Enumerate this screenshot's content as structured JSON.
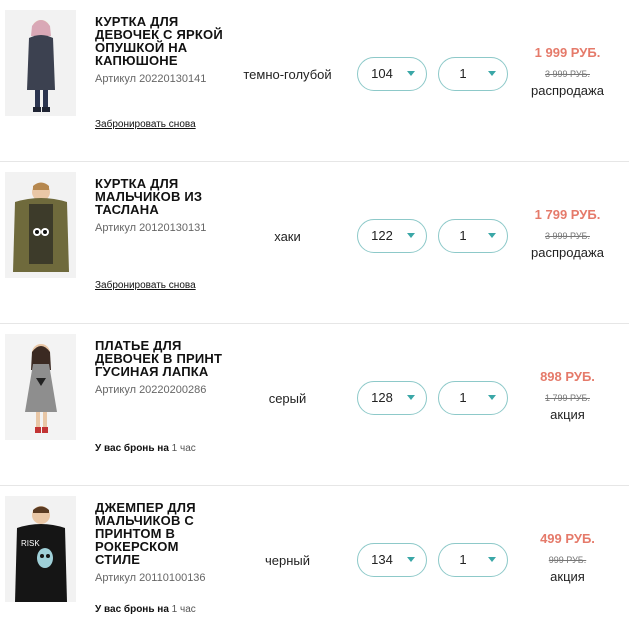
{
  "items": [
    {
      "title": "КУРТКА ДЛЯ ДЕВОЧЕК С ЯРКОЙ ОПУШКОЙ НА КАПЮШОНЕ",
      "sku": "Артикул 20220130141",
      "color": "темно-голубой",
      "size": "104",
      "qty": "1",
      "price": "1 999 РУБ.",
      "old_price": "3 999 РУБ.",
      "tag": "распродажа",
      "action": "Забронировать снова",
      "thumb_icon": "girl-jacket-photo"
    },
    {
      "title": "КУРТКА ДЛЯ МАЛЬЧИКОВ ИЗ ТАСЛАНА",
      "sku": "Артикул 20120130131",
      "color": "хаки",
      "size": "122",
      "qty": "1",
      "price": "1 799 РУБ.",
      "old_price": "3 999 РУБ.",
      "tag": "распродажа",
      "action": "Забронировать снова",
      "thumb_icon": "boy-jacket-photo"
    },
    {
      "title": "ПЛАТЬЕ ДЛЯ ДЕВОЧЕК В ПРИНТ ГУСИНАЯ ЛАПКА",
      "sku": "Артикул 20220200286",
      "color": "серый",
      "size": "128",
      "qty": "1",
      "price": "898 РУБ.",
      "old_price": "1 799 РУБ.",
      "tag": "акция",
      "reserve_prefix": "У вас бронь на",
      "reserve_time": "1 час",
      "thumb_icon": "girl-dress-photo"
    },
    {
      "title": "ДЖЕМПЕР ДЛЯ МАЛЬЧИКОВ С ПРИНТОМ В РОКЕРСКОМ СТИЛЕ",
      "sku": "Артикул 20110100136",
      "color": "черный",
      "size": "134",
      "qty": "1",
      "price": "499 РУБ.",
      "old_price": "999 РУБ.",
      "tag": "акция",
      "reserve_prefix": "У вас бронь на",
      "reserve_time": "1 час",
      "thumb_icon": "boy-sweater-photo"
    }
  ],
  "colors": {
    "accent_border": "#8dc9c9",
    "chevron": "#3aa7a7",
    "price": "#e57a6a"
  }
}
